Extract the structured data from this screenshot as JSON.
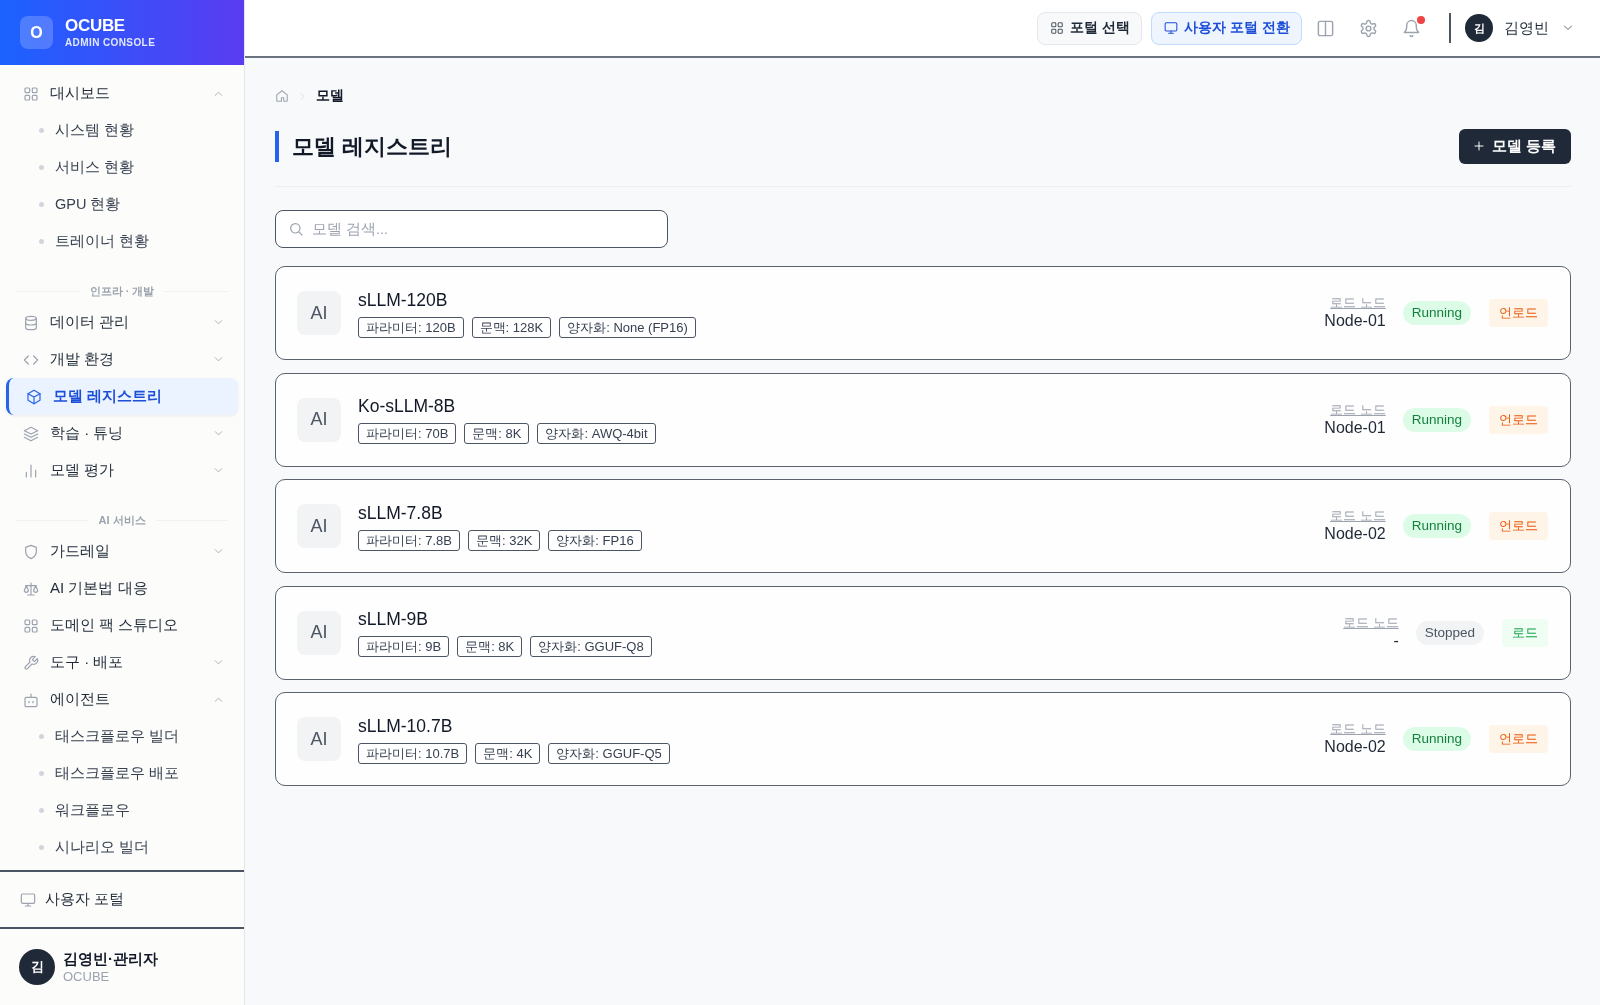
{
  "sidebar": {
    "brand": {
      "logo": "O",
      "name": "OCUBE",
      "subtitle": "ADMIN CONSOLE"
    },
    "sections": [
      {
        "items": [
          {
            "label": "대시보드",
            "selected": false,
            "expanded": true,
            "children": [
              {
                "label": "시스템 현황",
                "selected": false
              },
              {
                "label": "서비스 현황",
                "selected": false
              },
              {
                "label": "GPU 현황",
                "selected": false
              },
              {
                "label": "트레이너 현황",
                "selected": false
              }
            ]
          }
        ]
      },
      {
        "title": "인프라 · 개발",
        "items": [
          {
            "label": "데이터 관리",
            "selected": false,
            "expanded": false
          },
          {
            "label": "개발 환경",
            "selected": false,
            "expanded": false
          },
          {
            "label": "모델 레지스트리",
            "selected": true
          },
          {
            "label": "학습 · 튜닝",
            "selected": false,
            "expanded": false
          },
          {
            "label": "모델 평가",
            "selected": false,
            "expanded": false
          }
        ]
      },
      {
        "title": "AI 서비스",
        "items": [
          {
            "label": "가드레일",
            "selected": false,
            "expanded": false
          },
          {
            "label": "AI 기본법 대응",
            "selected": false
          },
          {
            "label": "도메인 팩 스튜디오",
            "selected": false
          },
          {
            "label": "도구 · 배포",
            "selected": false,
            "expanded": false
          },
          {
            "label": "에이전트",
            "selected": false,
            "expanded": true,
            "children": [
              {
                "label": "태스크플로우 빌더",
                "selected": false
              },
              {
                "label": "태스크플로우 배포",
                "selected": false
              },
              {
                "label": "워크플로우",
                "selected": false
              },
              {
                "label": "시나리오 빌더",
                "selected": false
              }
            ]
          }
        ]
      }
    ],
    "portal_link": {
      "label": "사용자 포털"
    },
    "user": {
      "avatar": "김",
      "name": "김영빈·관리자",
      "org": "OCUBE"
    }
  },
  "topbar": {
    "buttons": [
      {
        "label": "포털 선택",
        "kind": "default"
      },
      {
        "label": "사용자 포털 전환",
        "kind": "primary"
      }
    ],
    "notifications": {
      "unread": true
    },
    "user": {
      "avatar": "김",
      "name": "김영빈"
    }
  },
  "breadcrumb": {
    "current": "모델"
  },
  "page": {
    "title": "모델 레지스트리",
    "action": "모델 등록"
  },
  "search": {
    "placeholder": "모델 검색..."
  },
  "models": [
    {
      "badge": "AI",
      "name": "sLLM-120B",
      "tags": [
        "파라미터: 120B",
        "문맥: 128K",
        "양자화: None (FP16)"
      ],
      "node_label": "로드 노드",
      "node": "Node-01",
      "running": true,
      "status": "Running",
      "action": {
        "label": "언로드",
        "kind": "unload"
      }
    },
    {
      "badge": "AI",
      "name": "Ko-sLLM-8B",
      "tags": [
        "파라미터: 70B",
        "문맥: 8K",
        "양자화: AWQ-4bit"
      ],
      "node_label": "로드 노드",
      "node": "Node-01",
      "running": true,
      "status": "Running",
      "action": {
        "label": "언로드",
        "kind": "unload"
      }
    },
    {
      "badge": "AI",
      "name": "sLLM-7.8B",
      "tags": [
        "파라미터: 7.8B",
        "문맥: 32K",
        "양자화: FP16"
      ],
      "node_label": "로드 노드",
      "node": "Node-02",
      "running": true,
      "status": "Running",
      "action": {
        "label": "언로드",
        "kind": "unload"
      }
    },
    {
      "badge": "AI",
      "name": "sLLM-9B",
      "tags": [
        "파라미터: 9B",
        "문맥: 8K",
        "양자화: GGUF-Q8"
      ],
      "node_label": "로드 노드",
      "node": "-",
      "running": false,
      "status": "Stopped",
      "action": {
        "label": "로드",
        "kind": "load"
      }
    },
    {
      "badge": "AI",
      "name": "sLLM-10.7B",
      "tags": [
        "파라미터: 10.7B",
        "문맥: 4K",
        "양자화: GGUF-Q5"
      ],
      "node_label": "로드 노드",
      "node": "Node-02",
      "running": true,
      "status": "Running",
      "action": {
        "label": "언로드",
        "kind": "unload"
      }
    }
  ]
}
